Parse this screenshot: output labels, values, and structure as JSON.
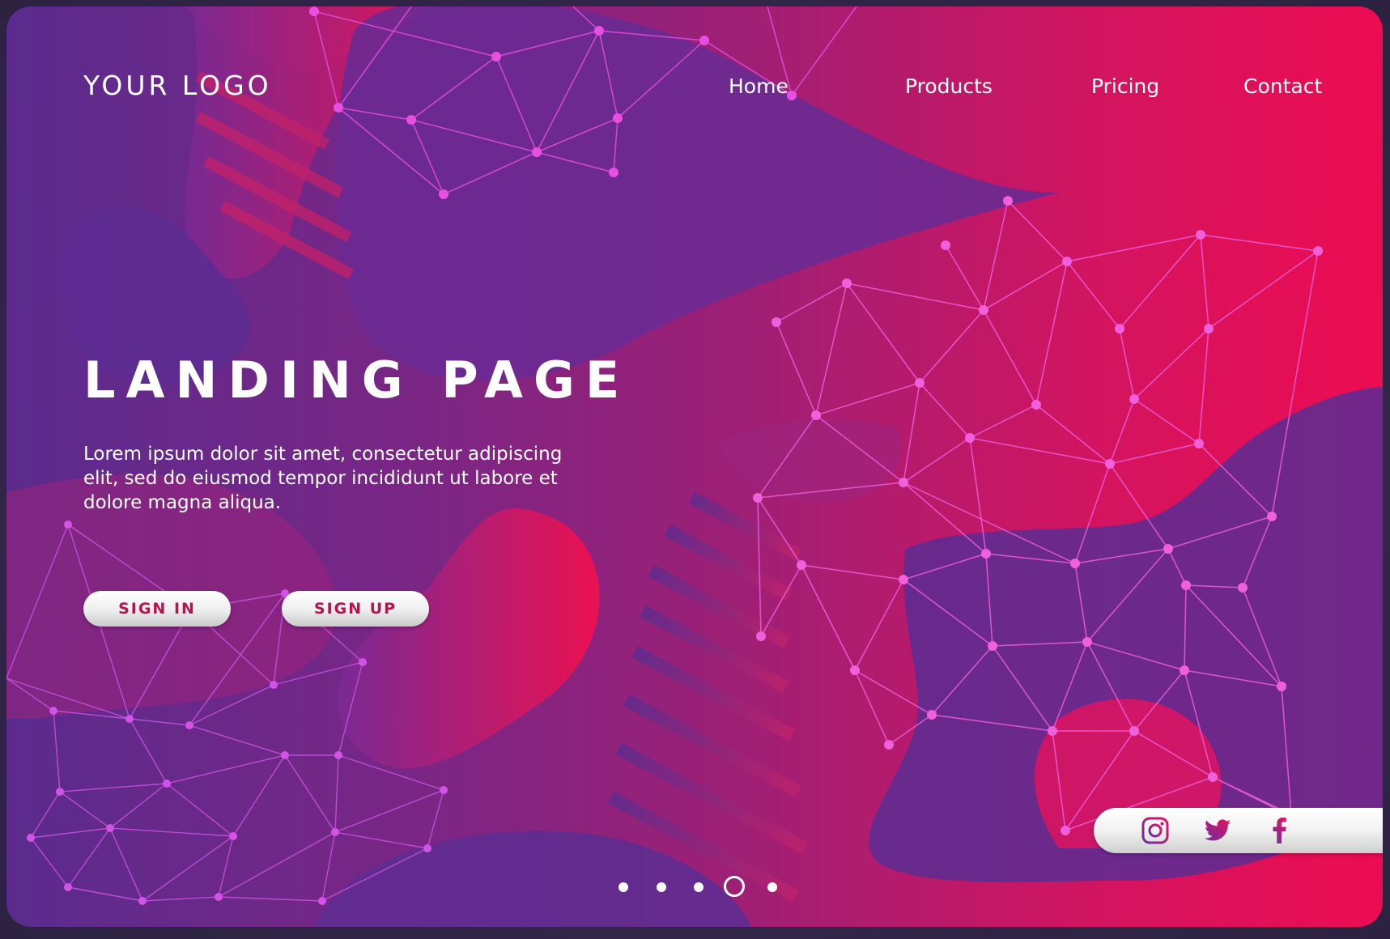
{
  "header": {
    "logo": "YOUR LOGO",
    "nav": [
      {
        "label": "Home"
      },
      {
        "label": "Products"
      },
      {
        "label": "Pricing"
      },
      {
        "label": "Contact"
      }
    ]
  },
  "hero": {
    "title": "LANDING PAGE",
    "body": "Lorem ipsum dolor sit amet, consectetur adipiscing elit, sed do eiusmod tempor incididunt ut labore et dolore magna aliqua.",
    "sign_in_label": "SIGN IN",
    "sign_up_label": "SIGN UP"
  },
  "social": {
    "icons": [
      "instagram-icon",
      "twitter-icon",
      "facebook-icon"
    ]
  },
  "carousel": {
    "slide_count": 5,
    "active_slide": 4
  },
  "colors": {
    "gradient_start": "#5a2b8d",
    "gradient_end": "#ec0c52",
    "network_line": "#e74fe0",
    "button_text": "#b3154f",
    "icon_gradient_start": "#6a2ea0",
    "icon_gradient_end": "#e8125c"
  }
}
